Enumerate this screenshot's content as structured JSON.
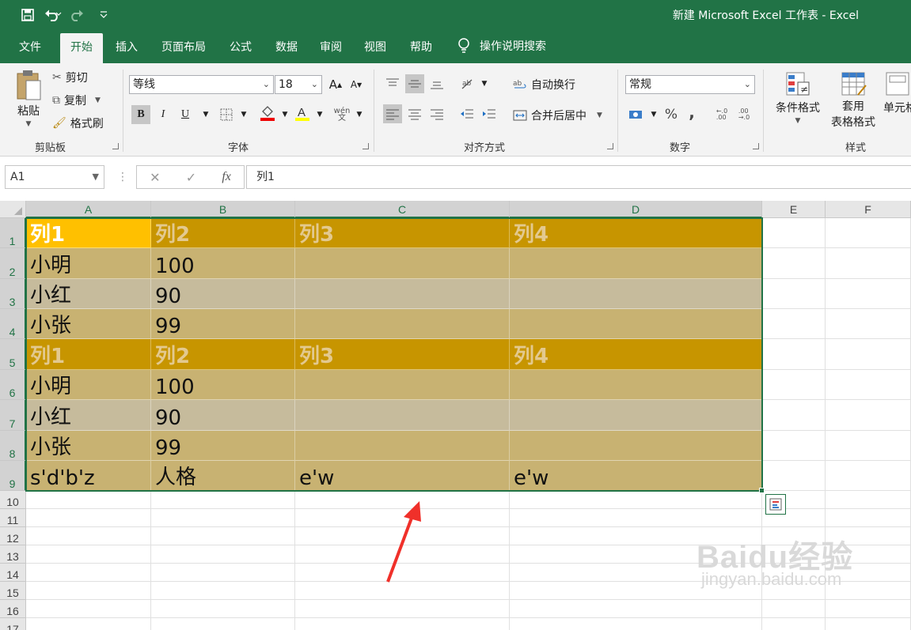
{
  "window": {
    "title": "新建 Microsoft Excel 工作表  -  Excel"
  },
  "colors": {
    "brand": "#217346",
    "header_fill": "#c79500",
    "a1_fill": "#ffc000",
    "band_dark": "#c8b272",
    "band_light": "#c6bb9c"
  },
  "tabs": [
    "文件",
    "开始",
    "插入",
    "页面布局",
    "公式",
    "数据",
    "审阅",
    "视图",
    "帮助"
  ],
  "tell_me": "操作说明搜索",
  "ribbon": {
    "clipboard": {
      "paste": "粘贴",
      "cut": "剪切",
      "copy": "复制",
      "format_painter": "格式刷",
      "label": "剪贴板"
    },
    "font": {
      "name": "等线",
      "size": "18",
      "label": "字体",
      "grow": "A",
      "shrink": "A",
      "bold": "B",
      "italic": "I",
      "underline": "U",
      "phonetic": "wén"
    },
    "alignment": {
      "wrap": "自动换行",
      "merge": "合并后居中",
      "label": "对齐方式"
    },
    "number": {
      "format": "常规",
      "percent": "%",
      "comma": ",",
      "label": "数字",
      "inc_dec": "←.0\n.00",
      "dec_dec": ".00\n→.0"
    },
    "styles": {
      "conditional": "条件格式",
      "table_format_1": "套用",
      "table_format_2": "表格格式",
      "cell_styles": "单元格",
      "label": "样式"
    }
  },
  "formula_bar": {
    "name_box": "A1",
    "fx": "fx",
    "value": "列1"
  },
  "columns": [
    "A",
    "B",
    "C",
    "D",
    "E",
    "F"
  ],
  "rows": [
    "1",
    "2",
    "3",
    "4",
    "5",
    "6",
    "7",
    "8",
    "9",
    "10",
    "11",
    "12",
    "13",
    "14",
    "15",
    "16",
    "17"
  ],
  "cells": {
    "r1": [
      "列1",
      "列2",
      "列3",
      "列4"
    ],
    "r2": [
      "小明",
      "100",
      "",
      ""
    ],
    "r3": [
      "小红",
      "90",
      "",
      ""
    ],
    "r4": [
      "小张",
      "99",
      "",
      ""
    ],
    "r5": [
      "列1",
      "列2",
      "列3",
      "列4"
    ],
    "r6": [
      "小明",
      "100",
      "",
      ""
    ],
    "r7": [
      "小红",
      "90",
      "",
      ""
    ],
    "r8": [
      "小张",
      "99",
      "",
      ""
    ],
    "r9": [
      "s'd'b'z",
      "人格",
      "e'w",
      "e'w"
    ]
  },
  "watermark": {
    "brand": "Baidu经验",
    "url": "jingyan.baidu.com"
  }
}
